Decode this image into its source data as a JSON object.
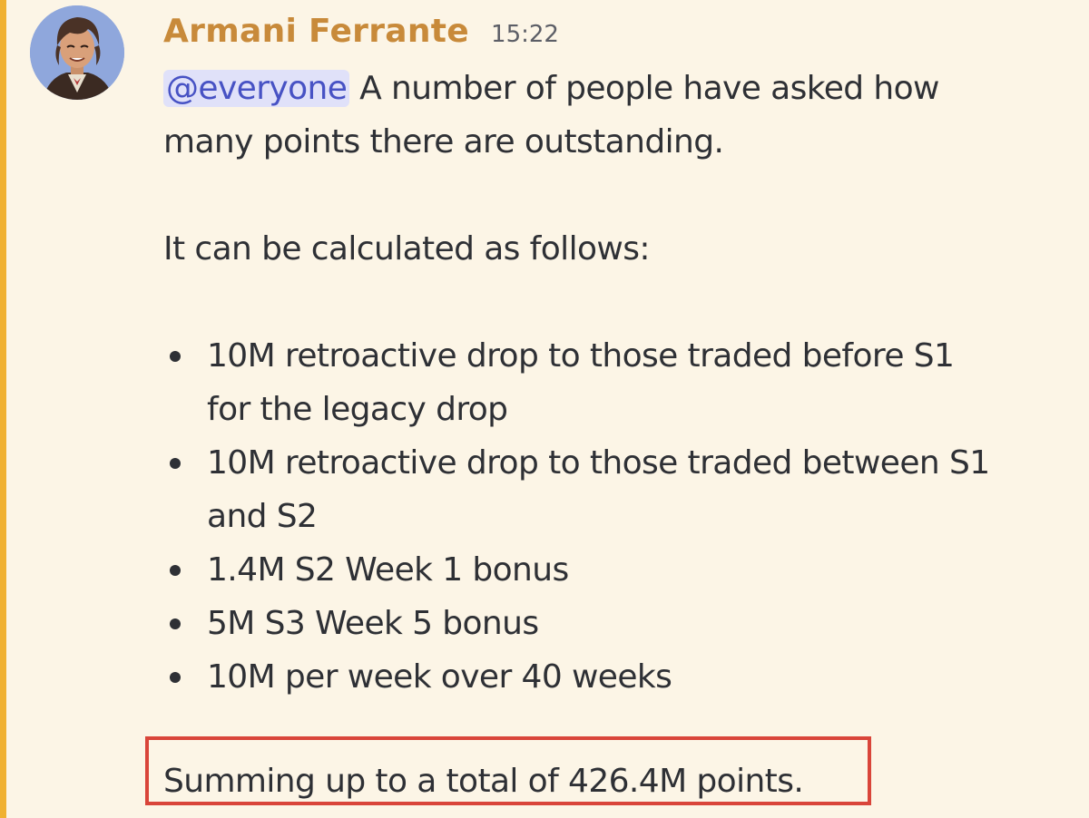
{
  "message": {
    "author": "Armani Ferrante",
    "timestamp": "15:22",
    "mention": "@everyone",
    "intro_line_1": " A number of people have asked how",
    "intro_line_2": "many points there are outstanding.",
    "calc_intro": "It can be calculated as follows:",
    "bullets": [
      {
        "line1": "10M retroactive drop to those traded before S1",
        "line2": "for the legacy drop"
      },
      {
        "line1": "10M retroactive drop to those traded between S1",
        "line2": "and S2"
      },
      {
        "line1": "1.4M S2 Week 1 bonus"
      },
      {
        "line1": "5M S3 Week 5 bonus"
      },
      {
        "line1": "10M per week over 40 weeks"
      }
    ],
    "summary": "Summing up to a total of 426.4M points."
  },
  "colors": {
    "background": "#fcf5e6",
    "highlight_bar": "#f0b132",
    "author_name": "#c88a3a",
    "mention_text": "#4752c4",
    "mention_bg": "#e0e1f9",
    "callout_border": "#d9453a"
  },
  "icons": {
    "avatar": "user-avatar"
  }
}
